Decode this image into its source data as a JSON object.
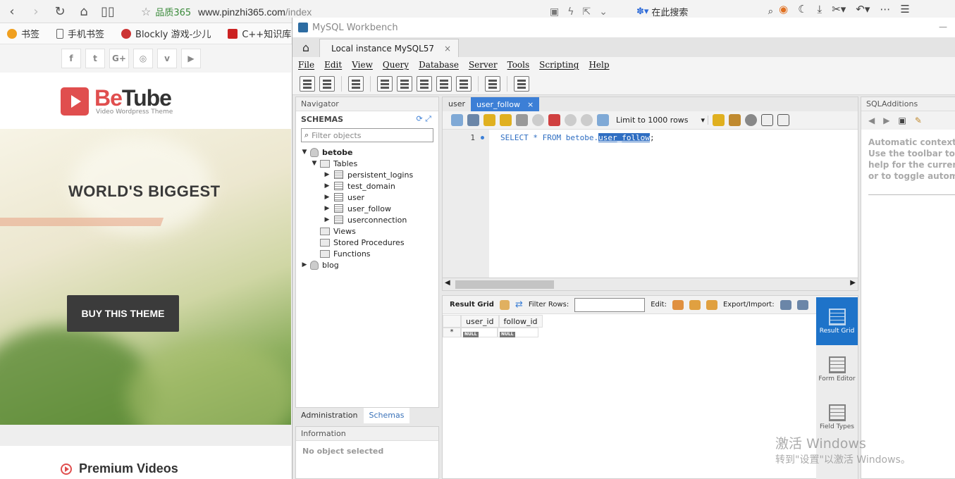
{
  "browser": {
    "site_name": "品质365",
    "url_host": "www.pinzhi365.com",
    "url_path": "/index",
    "search_placeholder": "在此搜索"
  },
  "bookmarks": [
    {
      "label": "书签",
      "color": "#f0a020"
    },
    {
      "label": "手机书签",
      "color": "#666666"
    },
    {
      "label": "Blockly 游戏-少儿",
      "color": "#cc3333"
    },
    {
      "label": "C++知识库 - 知识",
      "color": "#cc2222"
    }
  ],
  "site": {
    "social": [
      "f",
      "t",
      "G+",
      "◎",
      "v",
      "▶"
    ],
    "logo_be": "Be",
    "logo_tube": "Tube",
    "logo_sub": "Video Wordpress Theme",
    "hero_title": "WORLD'S BIGGEST",
    "hero_btn": "BUY THIS THEME",
    "section_title": "Premium Videos"
  },
  "workbench": {
    "window_title": "MySQL Workbench",
    "connection_tab": "Local instance MySQL57",
    "menu": [
      "File",
      "Edit",
      "View",
      "Query",
      "Database",
      "Server",
      "Tools",
      "Scripting",
      "Help"
    ],
    "navigator": {
      "title": "Navigator",
      "schemas_label": "SCHEMAS",
      "filter_placeholder": "Filter objects",
      "schema1": "betobe",
      "tables_label": "Tables",
      "tables": [
        "persistent_logins",
        "test_domain",
        "user",
        "user_follow",
        "userconnection"
      ],
      "views": "Views",
      "procs": "Stored Procedures",
      "funcs": "Functions",
      "schema2": "blog",
      "tab_admin": "Administration",
      "tab_schemas": "Schemas",
      "info_title": "Information",
      "info_text": "No object selected"
    },
    "editor": {
      "tab1": "user",
      "tab2": "user_follow",
      "limit_label": "Limit to 1000 rows",
      "line_no": "1",
      "code_prefix": "SELECT * FROM betobe.",
      "code_sel": "user_follow",
      "code_suffix": ";"
    },
    "result": {
      "grid_label": "Result Grid",
      "filter_label": "Filter Rows:",
      "edit_label": "Edit:",
      "export_label": "Export/Import:",
      "columns": [
        "user_id",
        "follow_id"
      ],
      "null_text": "NULL",
      "new_row_marker": "*"
    },
    "side_tabs": [
      "Result Grid",
      "Form Editor",
      "Field Types"
    ],
    "sqladditions": {
      "title": "SQLAdditions",
      "text": [
        "Automatic context",
        "Use the toolbar to m",
        "help for the curren",
        "or to toggle automa"
      ]
    }
  },
  "watermark": {
    "line1": "激活 Windows",
    "line2": "转到\"设置\"以激活 Windows。"
  }
}
